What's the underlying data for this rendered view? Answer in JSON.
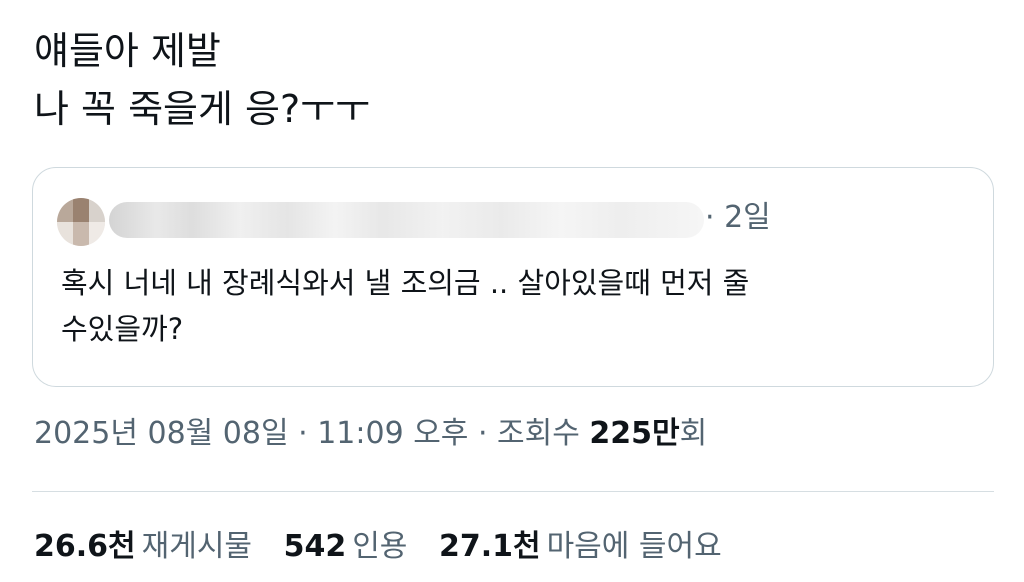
{
  "tweet": {
    "lines": [
      "얘들아 제발",
      "나 꼭 죽을게 응?ㅜㅜ"
    ]
  },
  "quote": {
    "time": "2일",
    "body_lines": [
      "혹시 너네 내 장례식와서 낼 조의금 .. 살아있을때 먼저 줄",
      "수있을까?"
    ]
  },
  "meta": {
    "date": "2025년 08월 08일",
    "time": "11:09 오후",
    "views_label": "조회수",
    "views_value": "225만",
    "views_unit": "회"
  },
  "stats": {
    "retweets_value": "26.6천",
    "retweets_label": "재게시물",
    "quotes_value": "542",
    "quotes_label": "인용",
    "likes_value": "27.1천",
    "likes_label": "마음에 들어요"
  },
  "colors": {
    "text": "#0f1419",
    "secondary": "#536471",
    "border": "#cfd9de"
  }
}
